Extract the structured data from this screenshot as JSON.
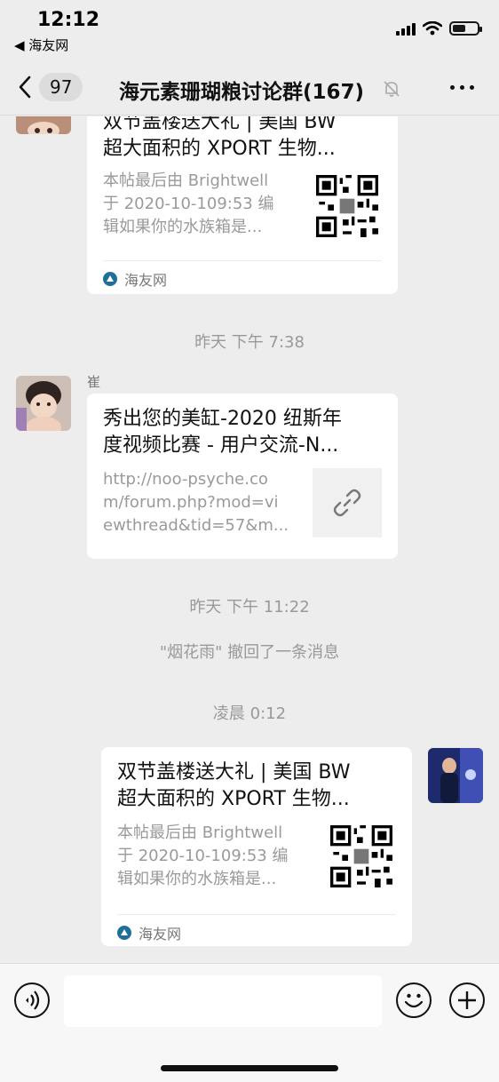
{
  "status_bar": {
    "time": "12:12",
    "back_app": "◀ 海友网",
    "battery_level": 0.55
  },
  "nav": {
    "back_count": "97",
    "title": "海元素珊瑚粮讨论群(167)",
    "mute_icon": "bell-slash-icon",
    "more_icon": "ellipsis-icon"
  },
  "messages": {
    "card1": {
      "title_line1": "双节盖楼送大礼 | 美国 BW",
      "title_line2": "超大面积的 XPORT 生物...",
      "desc_line1": "本帖最后由 Brightwell",
      "desc_line2": "于 2020-10-109:53 编",
      "desc_line3": "辑如果你的水族箱是...",
      "source": "海友网"
    },
    "time1": "昨天 下午 7:38",
    "sender2": "崔",
    "card2": {
      "title_line1": "秀出您的美缸-2020 纽斯年",
      "title_line2": "度视频比赛 - 用户交流-N...",
      "desc_line1": "http://noo-psyche.co",
      "desc_line2": "m/forum.php?mod=vi",
      "desc_line3": "ewthread&tid=57&m...",
      "thumb_icon": "link-icon"
    },
    "time2": "昨天 下午 11:22",
    "system_msg": "\"烟花雨\" 撤回了一条消息",
    "time3": "凌晨 0:12",
    "card3": {
      "title_line1": "双节盖楼送大礼 | 美国 BW",
      "title_line2": "超大面积的 XPORT 生物...",
      "desc_line1": "本帖最后由 Brightwell",
      "desc_line2": "于 2020-10-109:53 编",
      "desc_line3": "辑如果你的水族箱是...",
      "source": "海友网"
    }
  },
  "input_bar": {
    "voice_icon": "voice-icon",
    "emoji_icon": "smiley-icon",
    "add_icon": "plus-icon",
    "message_value": ""
  }
}
